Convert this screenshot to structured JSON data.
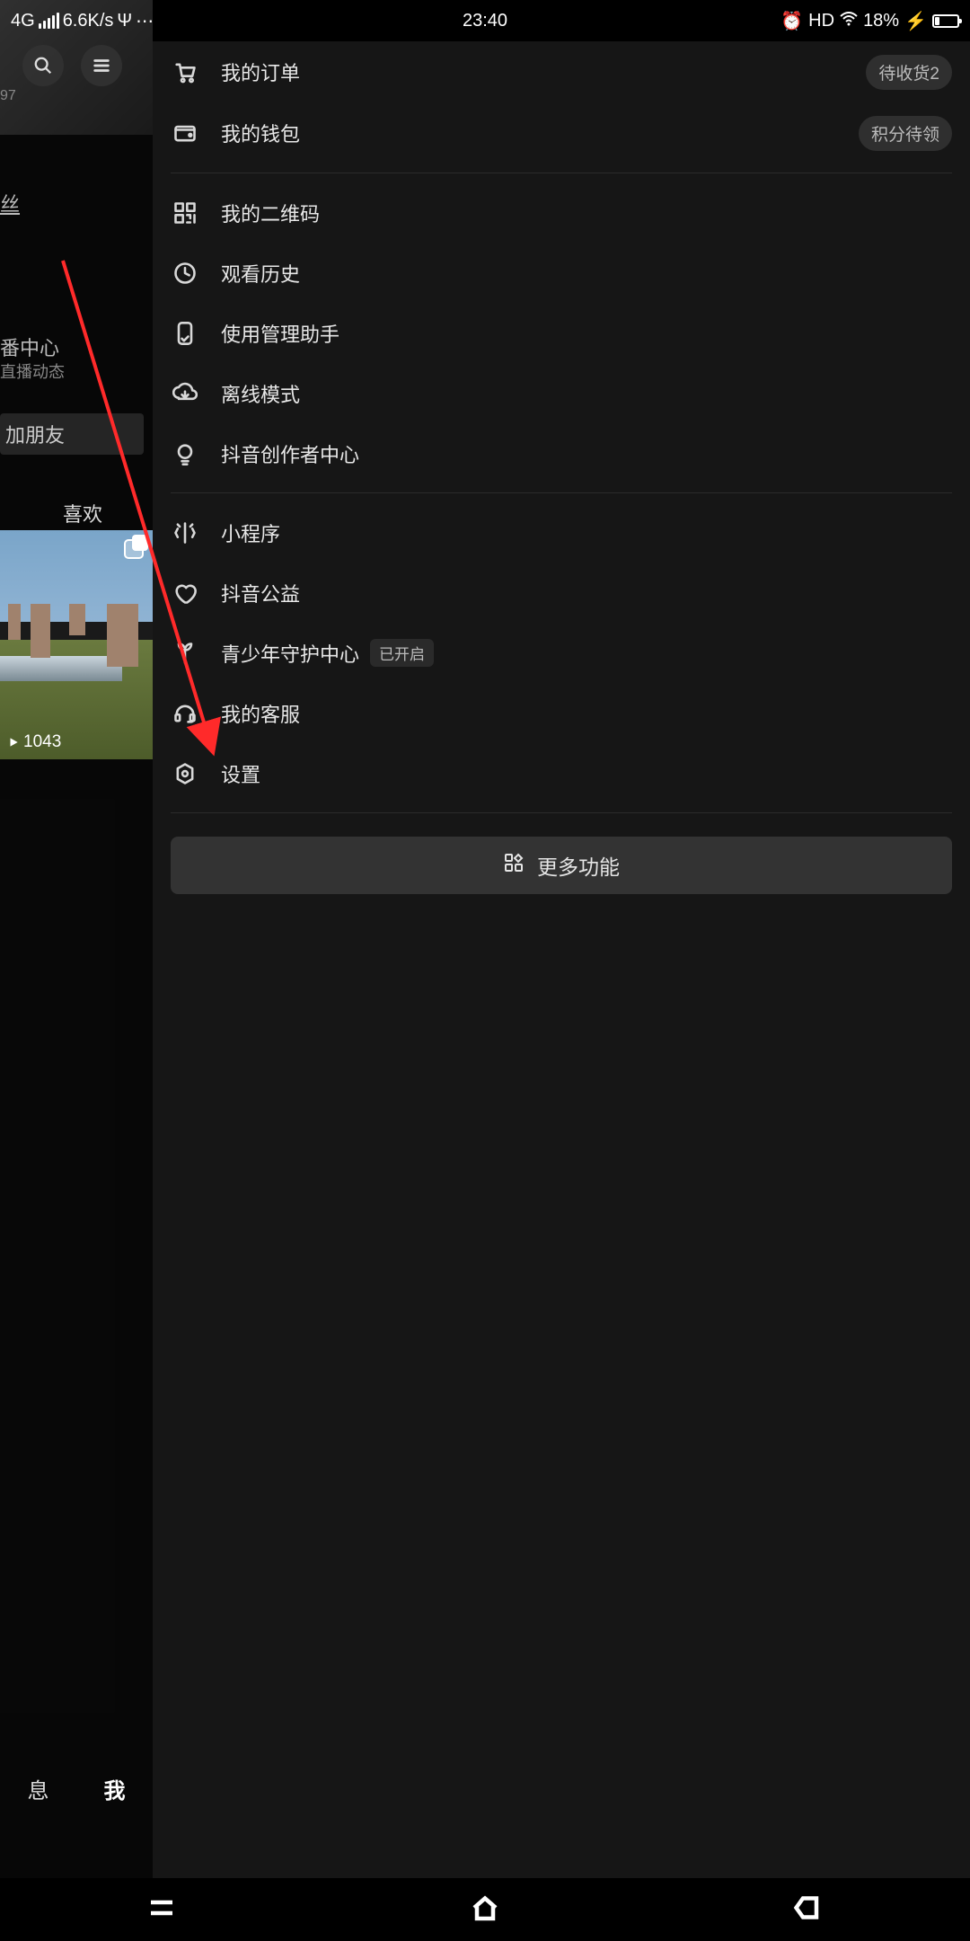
{
  "status": {
    "network": "4G",
    "speed": "6.6K/s",
    "time": "23:40",
    "hd": "HD",
    "battery_pct": "18%"
  },
  "profile": {
    "corner_text": "97",
    "fans_partial": "丝",
    "center_line1": "番中心",
    "center_line2": "直播动态",
    "add_friend_partial": "加朋友",
    "like_tab": "喜欢",
    "play_count": "1043",
    "tab_msg": "息",
    "tab_me": "我"
  },
  "menu": {
    "orders": {
      "label": "我的订单",
      "badge": "待收货2"
    },
    "wallet": {
      "label": "我的钱包",
      "badge": "积分待领"
    },
    "qrcode": {
      "label": "我的二维码"
    },
    "history": {
      "label": "观看历史"
    },
    "assistant": {
      "label": "使用管理助手"
    },
    "offline": {
      "label": "离线模式"
    },
    "creator": {
      "label": "抖音创作者中心"
    },
    "miniapp": {
      "label": "小程序"
    },
    "charity": {
      "label": "抖音公益"
    },
    "teen": {
      "label": "青少年守护中心",
      "badge": "已开启"
    },
    "service": {
      "label": "我的客服"
    },
    "settings": {
      "label": "设置"
    },
    "more": {
      "label": "更多功能"
    }
  }
}
